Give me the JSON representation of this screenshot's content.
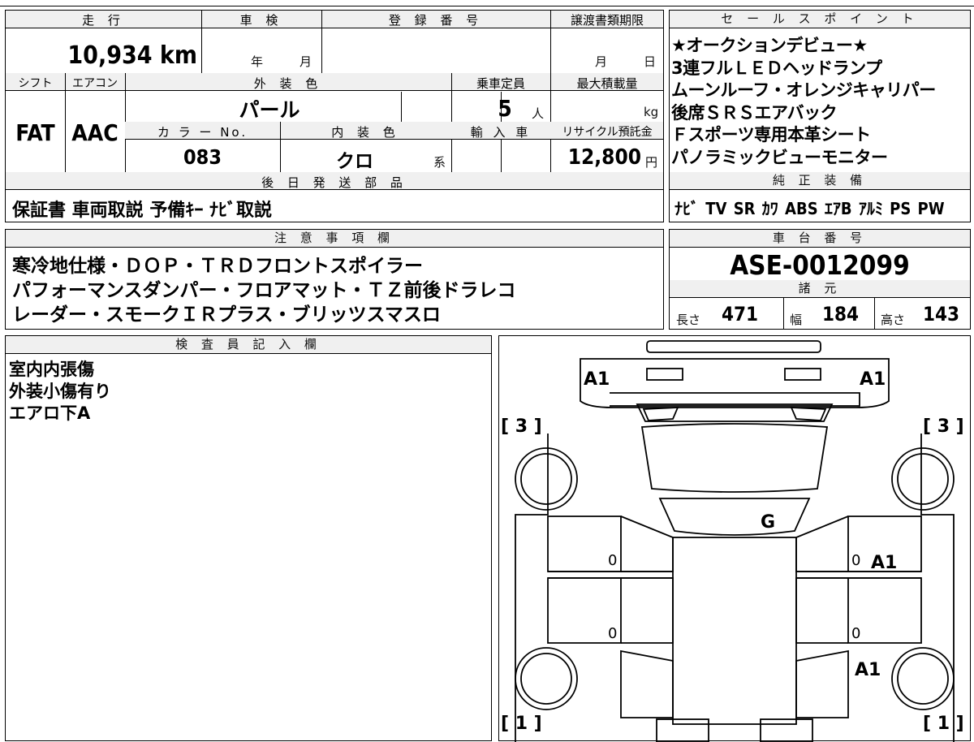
{
  "table": {
    "h_mileage": "走 行",
    "h_inspection": "車 検",
    "h_regno": "登 録 番 号",
    "h_transfer": "譲渡書類期限",
    "mileage": "10,934 km",
    "insp_year": "年",
    "insp_month": "月",
    "transfer_month": "月",
    "transfer_day": "日",
    "h_shift": "シフト",
    "h_ac": "エアコン",
    "h_exterior": "外 装 色",
    "h_capacity": "乗車定員",
    "h_maxload": "最大積載量",
    "shift": "FAT",
    "ac": "AAC",
    "exterior_color": "パール",
    "capacity": "5",
    "capacity_unit": "人",
    "maxload_unit": "kg",
    "h_colorno": "カ ラ ー No.",
    "h_interior": "内 装 色",
    "h_import": "輸 入 車",
    "h_recycle": "リサイクル預託金",
    "color_no": "083",
    "interior_color": "クロ",
    "interior_suffix": "系",
    "recycle_fee": "12,800",
    "recycle_unit": "円",
    "h_later_parts": "後 日 発 送 部 品",
    "later_parts": "保証書 車両取説 予備ｷｰ ﾅﾋﾞ取説"
  },
  "sales": {
    "header": "セ ー ル ス ポ イ ン ト",
    "points": "★オークションデビュー★\n3連フルＬＥＤヘッドランプ\nムーンルーフ・オレンジキャリパー\n後席ＳＲＳエアバック\nＦスポーツ専用本革シート\nパノラミックビューモニター",
    "h_equipment": "純 正 装 備",
    "equipment": "ﾅﾋﾞ TV SR ｶﾜ ABS ｴｱB ｱﾙﾐ PS PW"
  },
  "notes": {
    "header": "注 意 事 項 欄",
    "text": "寒冷地仕様・ＤＯＰ・ＴＲＤフロントスポイラー\nパフォーマンスダンパー・フロアマット・ＴＺ前後ドラレコ\nレーダー・スモークＩＲプラス・ブリッツスマスロ"
  },
  "chassis": {
    "header": "車 台 番 号",
    "number": "ASE-0012099",
    "h_specs": "諸 元",
    "l_length": "長さ",
    "length": "471",
    "l_width": "幅",
    "width": "184",
    "l_height": "高さ",
    "height": "143"
  },
  "inspector": {
    "header": "検 査 員 記 入 欄",
    "text": "室内内張傷\n外装小傷有り\nエアロ下A"
  },
  "diagram": {
    "mark_front_left": "A1",
    "mark_front_right": "A1",
    "mark_left_front": "[ 3 ]",
    "mark_right_front": "[ 3 ]",
    "mark_roof": "G",
    "mark_right_door": "A1",
    "mark_right_rear": "A1",
    "mark_left_rear": "[ 1 ]",
    "mark_right_rear_num": "[ 1 ]",
    "zero_1": "0",
    "zero_2": "0",
    "zero_3": "0",
    "zero_4": "0"
  }
}
